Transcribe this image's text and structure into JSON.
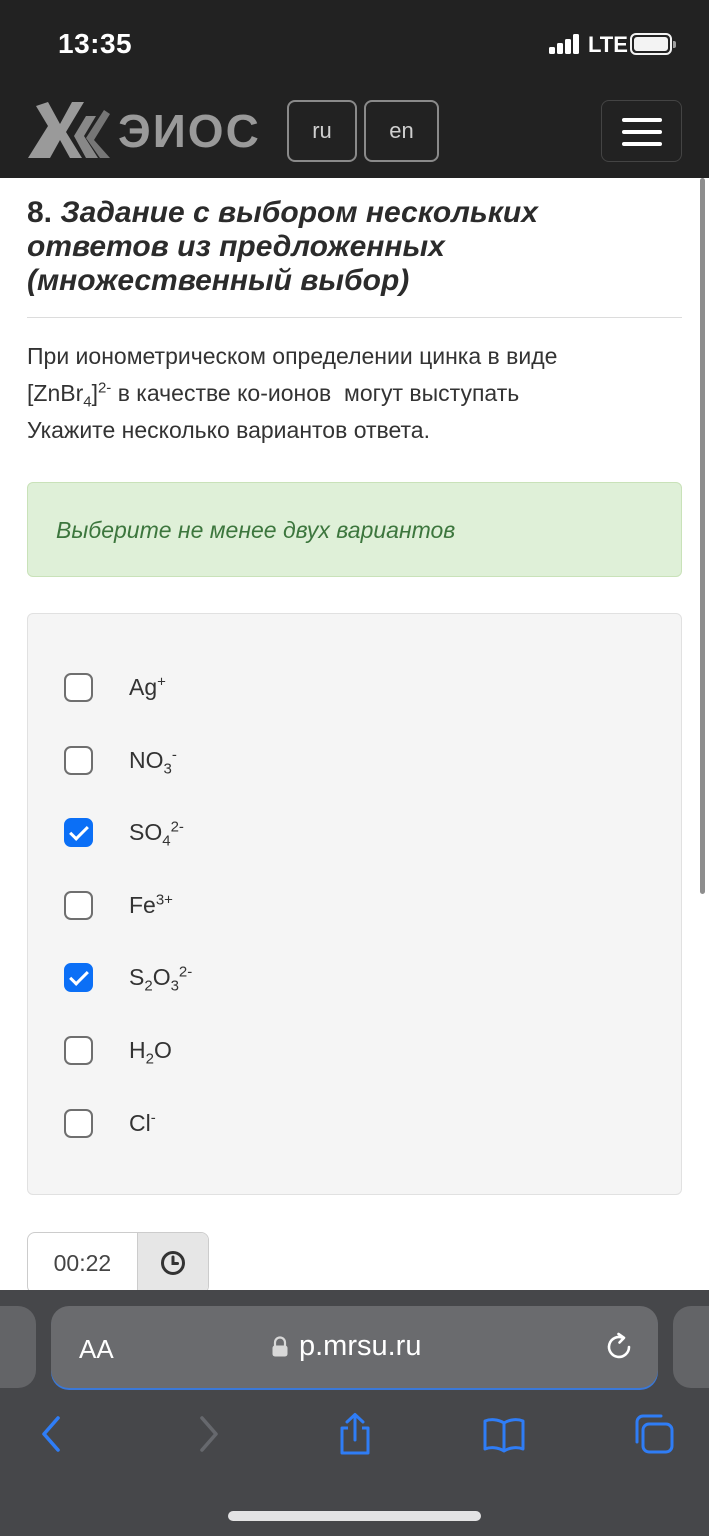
{
  "status_bar": {
    "time": "13:35",
    "network": "LTE"
  },
  "header": {
    "logo_text": "ЭИОС",
    "lang_ru": "ru",
    "lang_en": "en",
    "menu_icon": "hamburger-icon"
  },
  "question": {
    "number": "8.",
    "title": "Задание с выбором нескольких ответов из предложенных (множественный выбор)",
    "body_line1": "При ионометрическом определении цинка в виде",
    "complex_prefix": "[ZnBr",
    "complex_sub": "4",
    "complex_bracket": "]",
    "complex_sup": "2-",
    "body_line2_rest": " в качестве ко-ионов  могут выступать",
    "body_line3": "Укажите несколько вариантов ответа."
  },
  "alert": {
    "text": "Выберите не менее двух вариантов"
  },
  "options": [
    {
      "base": "Ag",
      "sub1": "",
      "mid": "",
      "sub2": "",
      "sup": "+",
      "checked": false
    },
    {
      "base": "NO",
      "sub1": "3",
      "mid": "",
      "sub2": "",
      "sup": "-",
      "checked": false
    },
    {
      "base": "SO",
      "sub1": "4",
      "mid": "",
      "sub2": "",
      "sup": "2-",
      "checked": true
    },
    {
      "base": "Fe",
      "sub1": "",
      "mid": "",
      "sub2": "",
      "sup": "3+",
      "checked": false
    },
    {
      "base": "S",
      "sub1": "2",
      "mid": "O",
      "sub2": "3",
      "sup": "2-",
      "checked": true
    },
    {
      "base": "H",
      "sub1": "2",
      "mid": "O",
      "sub2": "",
      "sup": "",
      "checked": false
    },
    {
      "base": "Cl",
      "sub1": "",
      "mid": "",
      "sub2": "",
      "sup": "-",
      "checked": false
    }
  ],
  "timer": {
    "value": "00:22",
    "icon": "clock-icon"
  },
  "browser": {
    "text_size_label": "AA",
    "url": "p.mrsu.ru",
    "icons": [
      "back-icon",
      "forward-icon",
      "share-icon",
      "bookmarks-icon",
      "tabs-icon"
    ]
  },
  "colors": {
    "header_bg": "#222222",
    "accent_checkbox": "#0b6ff6",
    "alert_bg": "#dff0d8",
    "alert_text": "#3c763d",
    "browser_bg": "#46474a",
    "browser_blue": "#2f7df6"
  }
}
